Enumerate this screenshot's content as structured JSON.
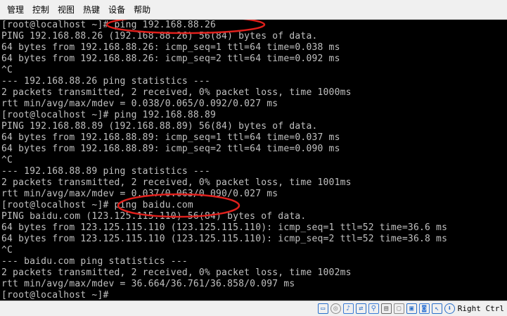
{
  "menu": [
    {
      "id": "manage",
      "label": "管理"
    },
    {
      "id": "control",
      "label": "控制"
    },
    {
      "id": "view",
      "label": "视图"
    },
    {
      "id": "hotkey",
      "label": "热键"
    },
    {
      "id": "devices",
      "label": "设备"
    },
    {
      "id": "help",
      "label": "帮助"
    }
  ],
  "terminal": {
    "lines": [
      "[root@localhost ~]# ping 192.168.88.26",
      "PING 192.168.88.26 (192.168.88.26) 56(84) bytes of data.",
      "64 bytes from 192.168.88.26: icmp_seq=1 ttl=64 time=0.038 ms",
      "64 bytes from 192.168.88.26: icmp_seq=2 ttl=64 time=0.092 ms",
      "^C",
      "--- 192.168.88.26 ping statistics ---",
      "2 packets transmitted, 2 received, 0% packet loss, time 1000ms",
      "rtt min/avg/max/mdev = 0.038/0.065/0.092/0.027 ms",
      "[root@localhost ~]# ping 192.168.88.89",
      "PING 192.168.88.89 (192.168.88.89) 56(84) bytes of data.",
      "64 bytes from 192.168.88.89: icmp_seq=1 ttl=64 time=0.037 ms",
      "64 bytes from 192.168.88.89: icmp_seq=2 ttl=64 time=0.090 ms",
      "^C",
      "--- 192.168.88.89 ping statistics ---",
      "2 packets transmitted, 2 received, 0% packet loss, time 1001ms",
      "rtt min/avg/max/mdev = 0.037/0.063/0.090/0.027 ms",
      "[root@localhost ~]# ping baidu.com",
      "PING baidu.com (123.125.115.110) 56(84) bytes of data.",
      "64 bytes from 123.125.115.110 (123.125.115.110): icmp_seq=1 ttl=52 time=36.6 ms",
      "64 bytes from 123.125.115.110 (123.125.115.110): icmp_seq=2 ttl=52 time=36.8 ms",
      "^C",
      "--- baidu.com ping statistics ---",
      "2 packets transmitted, 2 received, 0% packet loss, time 1002ms",
      "rtt min/avg/max/mdev = 36.664/36.761/36.858/0.097 ms",
      "[root@localhost ~]#"
    ],
    "text_color": "#c0c0c0",
    "background": "#000000",
    "annotation_color": "#e0201c"
  },
  "statusbar": {
    "icons": [
      {
        "name": "hard-disk-icon",
        "color": "#2a6fc9"
      },
      {
        "name": "optical-drive-icon",
        "color": "#8a8a8a"
      },
      {
        "name": "audio-icon",
        "color": "#3b7bd6"
      },
      {
        "name": "network-icon",
        "color": "#2a6fc9"
      },
      {
        "name": "usb-icon",
        "color": "#3b7bd6"
      },
      {
        "name": "shared-folder-icon",
        "color": "#6a6a6a"
      },
      {
        "name": "display-icon",
        "color": "#8a8a8a"
      },
      {
        "name": "video-capture-icon",
        "color": "#2a6fc9"
      },
      {
        "name": "cpu-icon",
        "color": "#3b7bd6"
      },
      {
        "name": "mouse-integration-icon",
        "color": "#2a6fc9"
      },
      {
        "name": "keyboard-capture-icon",
        "color": "#2a6fc9"
      }
    ],
    "host_key": "Right Ctrl"
  }
}
